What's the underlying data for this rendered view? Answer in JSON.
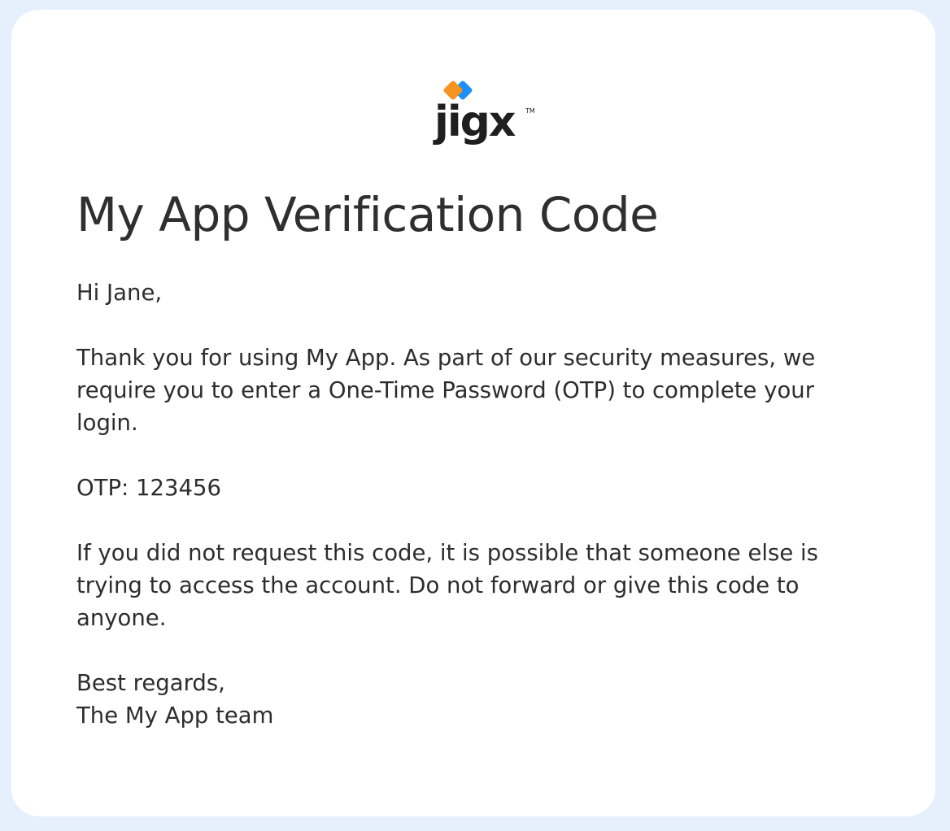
{
  "brand": {
    "logo_text": "jigx",
    "trademark": "TM",
    "colors": {
      "orange": "#f7931e",
      "blue": "#1e8ff7",
      "text": "#1f1f1f"
    }
  },
  "email": {
    "title": "My App Verification Code",
    "greeting": "Hi Jane,",
    "intro": "Thank you for using My App. As part of our security measures, we require you to enter a One-Time Password (OTP) to complete your login.",
    "otp_line": "OTP: 123456",
    "warning": "If you did not request this code, it is possible that someone else is trying to access the account. Do not forward or give this code to anyone.",
    "signoff_1": "Best regards,",
    "signoff_2": "The My App team"
  }
}
